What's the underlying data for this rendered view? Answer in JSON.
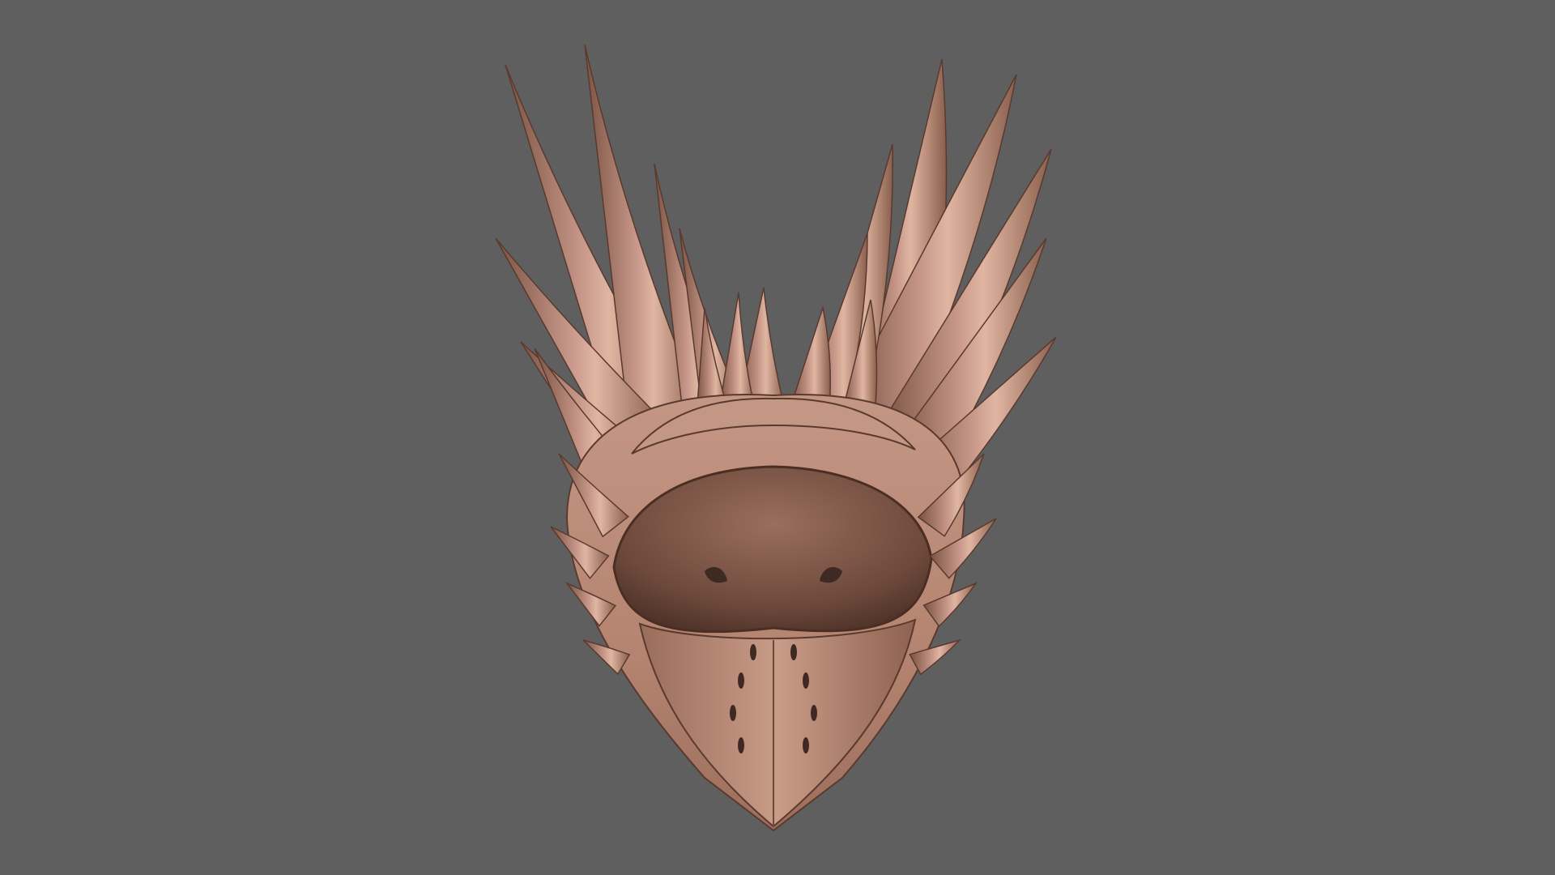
{
  "scene": {
    "background": "#5f5f5f",
    "subject_color": "#b98a76",
    "subject_shadow": "#6e4a3c",
    "subject_highlight": "#e0b6a2"
  }
}
